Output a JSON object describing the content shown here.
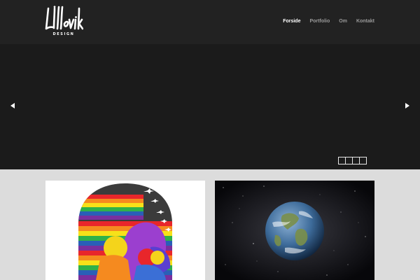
{
  "brand": {
    "logo_text": "Lillevik",
    "logo_subtitle": "DESIGN"
  },
  "nav": {
    "items": [
      {
        "label": "Forside",
        "active": true
      },
      {
        "label": "Portfolio",
        "active": false
      },
      {
        "label": "Om",
        "active": false
      },
      {
        "label": "Kontakt",
        "active": false
      }
    ]
  },
  "slider": {
    "prev_icon": "triangle-left-icon",
    "next_icon": "triangle-right-icon",
    "slide_count": 4
  },
  "colors": {
    "header_bg": "#222222",
    "slider_bg": "#1b1b1b",
    "content_bg": "#dcdcdc",
    "nav_active": "#ffffff",
    "nav_inactive": "#9a9a9a"
  }
}
